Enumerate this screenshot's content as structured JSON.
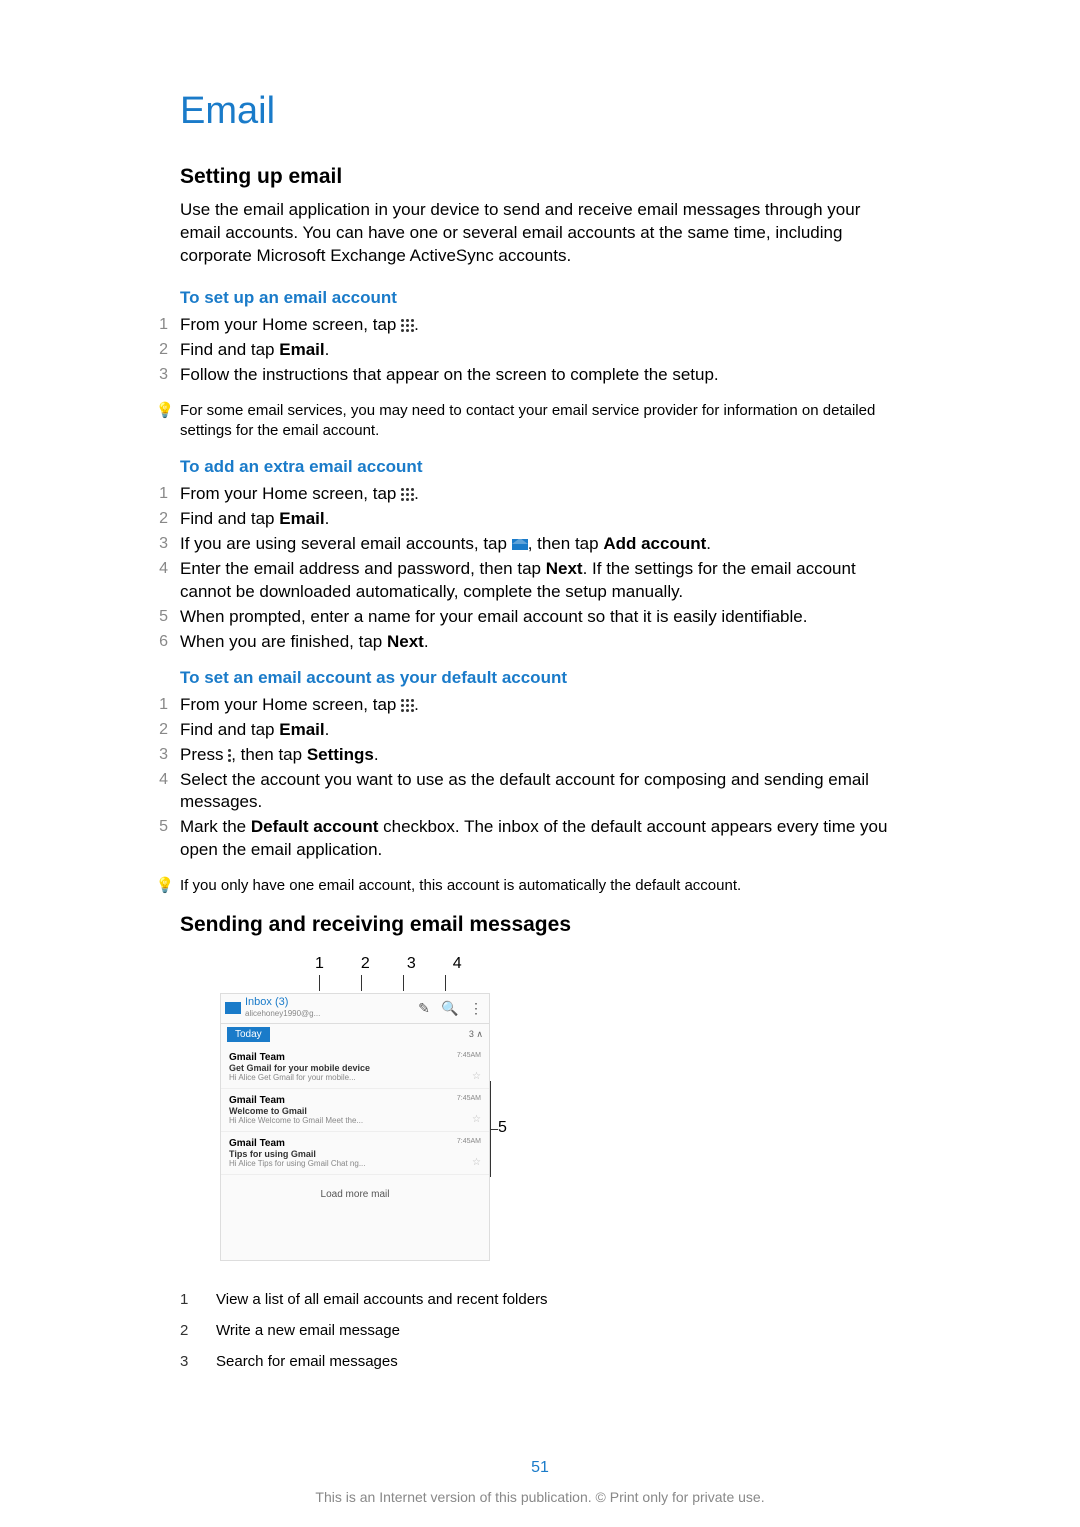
{
  "title": "Email",
  "section1": {
    "heading": "Setting up email",
    "intro": "Use the email application in your device to send and receive email messages through your email accounts. You can have one or several email accounts at the same time, including corporate Microsoft Exchange ActiveSync accounts.",
    "proc1": {
      "heading": "To set up an email account",
      "steps": [
        "From your Home screen, tap ",
        "Find and tap ",
        "Follow the instructions that appear on the screen to complete the setup."
      ],
      "email_label": "Email",
      "tip": "For some email services, you may need to contact your email service provider for information on detailed settings for the email account."
    },
    "proc2": {
      "heading": "To add an extra email account",
      "s1": "From your Home screen, tap ",
      "s2a": "Find and tap ",
      "s2b": "Email",
      "s3a": "If you are using several email accounts, tap ",
      "s3b": ", then tap ",
      "s3c": "Add account",
      "s4a": "Enter the email address and password, then tap ",
      "s4b": "Next",
      "s4c": ". If the settings for the email account cannot be downloaded automatically, complete the setup manually.",
      "s5": "When prompted, enter a name for your email account so that it is easily identifiable.",
      "s6a": "When you are finished, tap ",
      "s6b": "Next"
    },
    "proc3": {
      "heading": "To set an email account as your default account",
      "s1": "From your Home screen, tap ",
      "s2a": "Find and tap ",
      "s2b": "Email",
      "s3a": "Press ",
      "s3b": ", then tap ",
      "s3c": "Settings",
      "s4": "Select the account you want to use as the default account for composing and sending email messages.",
      "s5a": "Mark the ",
      "s5b": "Default account",
      "s5c": " checkbox. The inbox of the default account appears every time you open the email application.",
      "tip": "If you only have one email account, this account is automatically the default account."
    }
  },
  "section2": {
    "heading": "Sending and receiving email messages",
    "callouts": [
      "1",
      "2",
      "3",
      "4",
      "5"
    ],
    "shot": {
      "inbox_title": "Inbox (3)",
      "inbox_sub": "alicehoney1990@g...",
      "today": "Today",
      "count": "3 ∧",
      "items": [
        {
          "from": "Gmail Team",
          "subj": "Get Gmail for your mobile device",
          "prev": "Hi Alice Get Gmail for your mobile...",
          "time": "7:45AM"
        },
        {
          "from": "Gmail Team",
          "subj": "Welcome to Gmail",
          "prev": "Hi Alice Welcome to Gmail Meet the...",
          "time": "7:45AM"
        },
        {
          "from": "Gmail Team",
          "subj": "Tips for using Gmail",
          "prev": "Hi Alice Tips for using Gmail Chat ng...",
          "time": "7:45AM"
        }
      ],
      "load": "Load more mail"
    },
    "legend": [
      {
        "n": "1",
        "t": "View a list of all email accounts and recent folders"
      },
      {
        "n": "2",
        "t": "Write a new email message"
      },
      {
        "n": "3",
        "t": "Search for email messages"
      }
    ]
  },
  "page_num": "51",
  "footer": "This is an Internet version of this publication. © Print only for private use."
}
